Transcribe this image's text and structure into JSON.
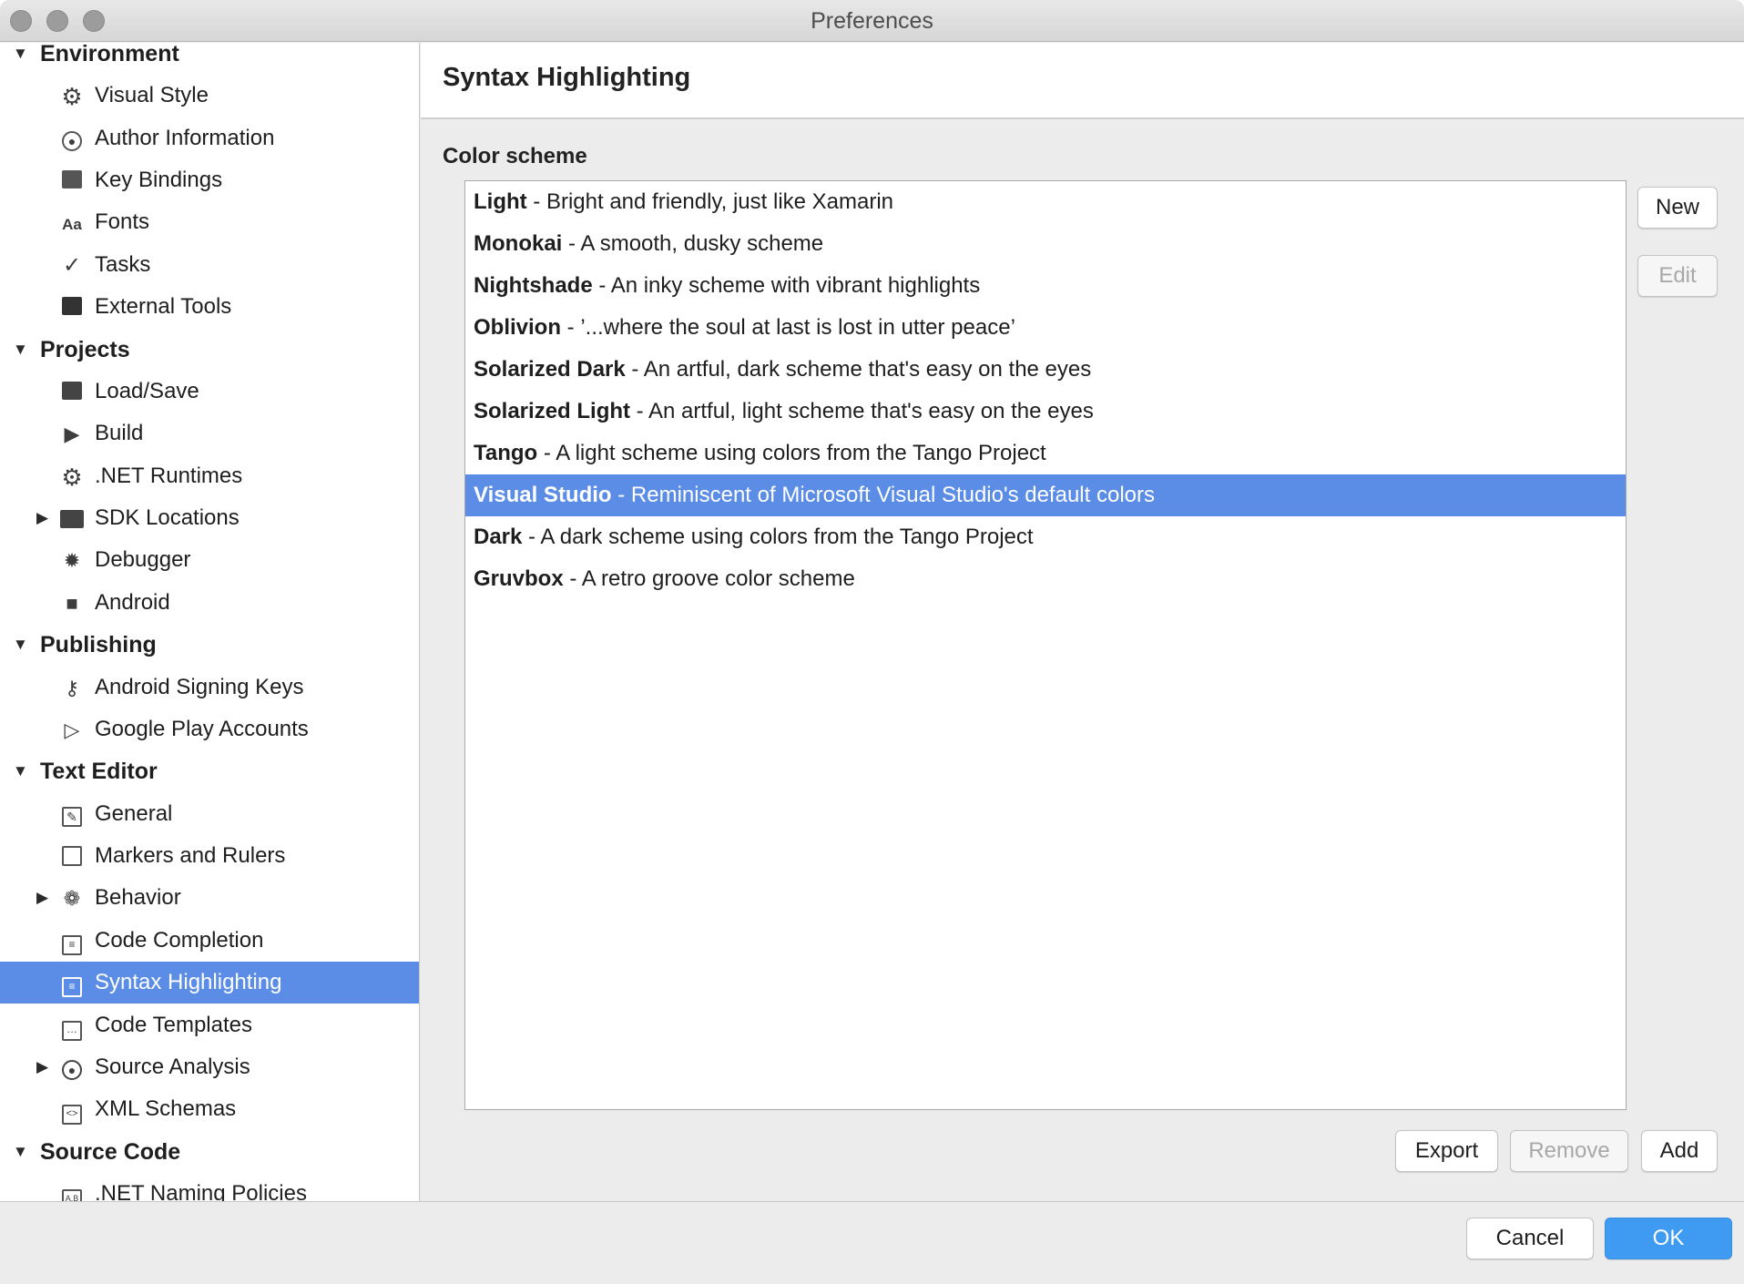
{
  "window": {
    "title": "Preferences"
  },
  "sidebar": {
    "rows": [
      {
        "kind": "category",
        "label": "Environment",
        "expanded": true
      },
      {
        "kind": "item",
        "label": "Visual Style",
        "icon": "gear-icon"
      },
      {
        "kind": "item",
        "label": "Author Information",
        "icon": "person-icon"
      },
      {
        "kind": "item",
        "label": "Key Bindings",
        "icon": "keyboard-icon"
      },
      {
        "kind": "item",
        "label": "Fonts",
        "icon": "font-icon"
      },
      {
        "kind": "item",
        "label": "Tasks",
        "icon": "checkmark-icon"
      },
      {
        "kind": "item",
        "label": "External Tools",
        "icon": "terminal-icon"
      },
      {
        "kind": "category",
        "label": "Projects",
        "expanded": true
      },
      {
        "kind": "item",
        "label": "Load/Save",
        "icon": "disk-icon"
      },
      {
        "kind": "item",
        "label": "Build",
        "icon": "build-icon"
      },
      {
        "kind": "item",
        "label": ".NET Runtimes",
        "icon": "gear-icon"
      },
      {
        "kind": "item",
        "label": "SDK Locations",
        "icon": "folder-icon",
        "collapsed": true
      },
      {
        "kind": "item",
        "label": "Debugger",
        "icon": "bug-icon"
      },
      {
        "kind": "item",
        "label": "Android",
        "icon": "android-icon"
      },
      {
        "kind": "category",
        "label": "Publishing",
        "expanded": true
      },
      {
        "kind": "item",
        "label": "Android Signing Keys",
        "icon": "key-icon"
      },
      {
        "kind": "item",
        "label": "Google Play Accounts",
        "icon": "play-icon"
      },
      {
        "kind": "category",
        "label": "Text Editor",
        "expanded": true
      },
      {
        "kind": "item",
        "label": "General",
        "icon": "pencil-icon"
      },
      {
        "kind": "item",
        "label": "Markers and Rulers",
        "icon": "grid-icon"
      },
      {
        "kind": "item",
        "label": "Behavior",
        "icon": "brain-icon",
        "collapsed": true
      },
      {
        "kind": "item",
        "label": "Code Completion",
        "icon": "list-icon"
      },
      {
        "kind": "item",
        "label": "Syntax Highlighting",
        "icon": "document-icon",
        "selected": true
      },
      {
        "kind": "item",
        "label": "Code Templates",
        "icon": "ellipsis-box-icon"
      },
      {
        "kind": "item",
        "label": "Source Analysis",
        "icon": "radio-icon",
        "collapsed": true
      },
      {
        "kind": "item",
        "label": "XML Schemas",
        "icon": "code-box-icon"
      },
      {
        "kind": "category",
        "label": "Source Code",
        "expanded": true
      },
      {
        "kind": "item",
        "label": ".NET Naming Policies",
        "icon": "naming-icon"
      }
    ]
  },
  "main": {
    "title": "Syntax Highlighting",
    "section_label": "Color scheme",
    "schemes": [
      {
        "name": "Light",
        "desc": " - Bright and friendly, just like Xamarin"
      },
      {
        "name": "Monokai",
        "desc": " - A smooth, dusky scheme"
      },
      {
        "name": "Nightshade",
        "desc": " - An inky scheme with vibrant highlights"
      },
      {
        "name": "Oblivion",
        "desc": " - ’...where the soul at last is lost in utter peace’"
      },
      {
        "name": "Solarized Dark",
        "desc": " - An artful, dark scheme that's easy on the eyes"
      },
      {
        "name": "Solarized Light",
        "desc": " - An artful, light scheme that's easy on the eyes"
      },
      {
        "name": "Tango",
        "desc": " - A light scheme using colors from the Tango Project"
      },
      {
        "name": "Visual Studio",
        "desc": " - Reminiscent of Microsoft Visual Studio's default colors",
        "selected": true
      },
      {
        "name": "Dark",
        "desc": " - A dark scheme using colors from the Tango Project"
      },
      {
        "name": "Gruvbox",
        "desc": " - A retro groove color scheme"
      }
    ],
    "buttons": {
      "new": "New",
      "edit": "Edit",
      "export": "Export",
      "remove": "Remove",
      "add": "Add"
    }
  },
  "footer": {
    "cancel": "Cancel",
    "ok": "OK"
  },
  "colors": {
    "selection": "#5b8de6",
    "primary_button": "#3f9bf2"
  }
}
